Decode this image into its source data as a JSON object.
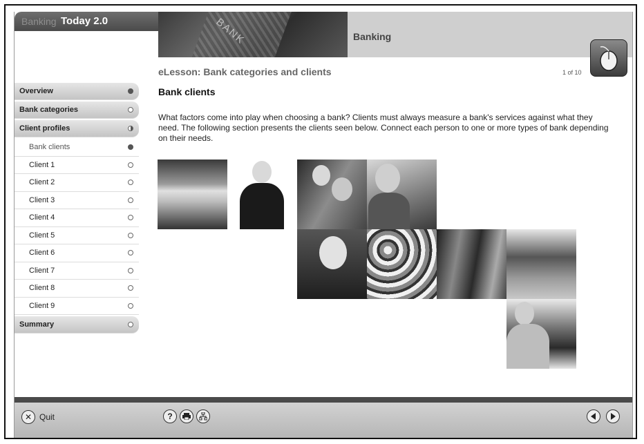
{
  "app": {
    "brand_faint": "Banking",
    "brand_title": "Today 2.0",
    "section_title": "Banking"
  },
  "lesson": {
    "title": "eLesson: Bank categories and clients",
    "pager": "1 of 10"
  },
  "nav": {
    "overview": "Overview",
    "bank_categories": "Bank categories",
    "client_profiles": "Client profiles",
    "items": [
      "Bank clients",
      "Client 1",
      "Client 2",
      "Client 3",
      "Client 4",
      "Client 5",
      "Client 6",
      "Client 7",
      "Client 8",
      "Client 9"
    ],
    "summary": "Summary"
  },
  "content": {
    "heading": "Bank clients",
    "paragraph": "What factors come into play when choosing a bank? Clients must always measure a bank's services against what they need. The following section presents the clients seen below. Connect each person to one or more types of bank depending on their needs."
  },
  "footer": {
    "quit": "Quit"
  },
  "icons": [
    "mouse-icon",
    "close-icon",
    "help-icon",
    "print-icon",
    "sitemap-icon",
    "prev-icon",
    "next-icon"
  ]
}
